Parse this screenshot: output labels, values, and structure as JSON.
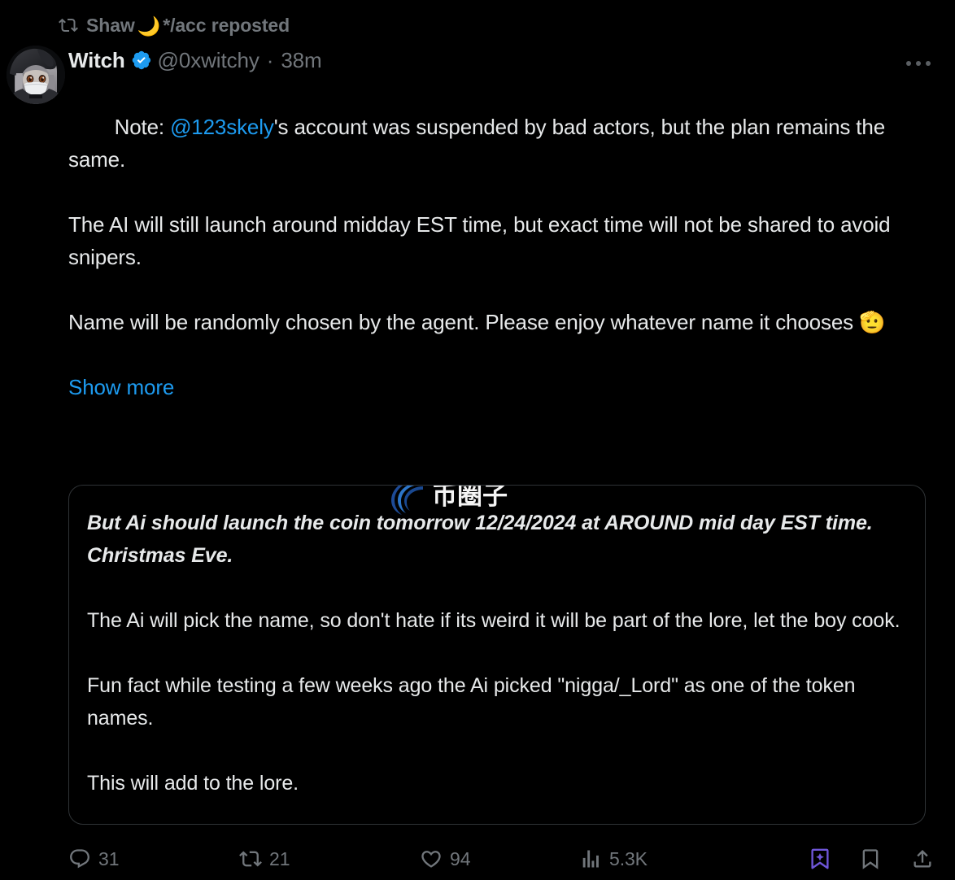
{
  "repost": {
    "icon": "repost-icon",
    "actor": "Shaw",
    "actor_emoji": "🌙",
    "suffix": "*/acc reposted"
  },
  "author": {
    "display_name": "Witch",
    "verified_icon": "verified-badge-icon",
    "handle": "@0xwitchy",
    "separator": "·",
    "timestamp": "38m",
    "avatar_alt": "hooded-anime-character-avatar"
  },
  "more_menu": {
    "icon": "more-horizontal-icon",
    "label": "More"
  },
  "post": {
    "segments": [
      {
        "type": "text",
        "value": "Note: "
      },
      {
        "type": "mention",
        "value": "@123skely"
      },
      {
        "type": "text",
        "value": "'s account was suspended by bad actors, but the plan remains the same.\n\nThe AI will still launch around midday EST time, but exact time will not be shared to avoid snipers.\n\nName will be randomly chosen by the agent. Please enjoy whatever name it chooses "
      },
      {
        "type": "emoji",
        "value": "🫡"
      }
    ],
    "show_more_label": "Show more"
  },
  "quoted_post": {
    "lead_text": "But Ai should launch the coin tomorrow 12/24/2024 at AROUND mid day EST time. Christmas Eve.",
    "body_text": "\n\nThe Ai will pick the name, so don't hate if its weird it will be part of the lore, let the boy cook.\n\nFun fact while testing a few weeks ago the Ai picked \"nigga/_Lord\" as one of the token names.\n\nThis will add to the lore."
  },
  "watermark": {
    "logo_icon": "swoosh-logo-icon",
    "text": "币圈子"
  },
  "actions": {
    "reply": {
      "icon": "reply-icon",
      "count": "31"
    },
    "repost": {
      "icon": "repost-icon",
      "count": "21"
    },
    "like": {
      "icon": "heart-icon",
      "count": "94"
    },
    "views": {
      "icon": "analytics-icon",
      "count": "5.3K"
    },
    "grok": {
      "icon": "grok-bookmark-sparkle-icon"
    },
    "bookmark": {
      "icon": "bookmark-icon"
    },
    "share": {
      "icon": "share-icon"
    }
  },
  "colors": {
    "background": "#000000",
    "text": "#e7e9ea",
    "muted": "#71767b",
    "link": "#1d9bf0",
    "verified": "#1d9bf0",
    "grok_purple": "#6e56d8",
    "border": "#2f3336",
    "watermark_blue": "#1b5fb4"
  }
}
